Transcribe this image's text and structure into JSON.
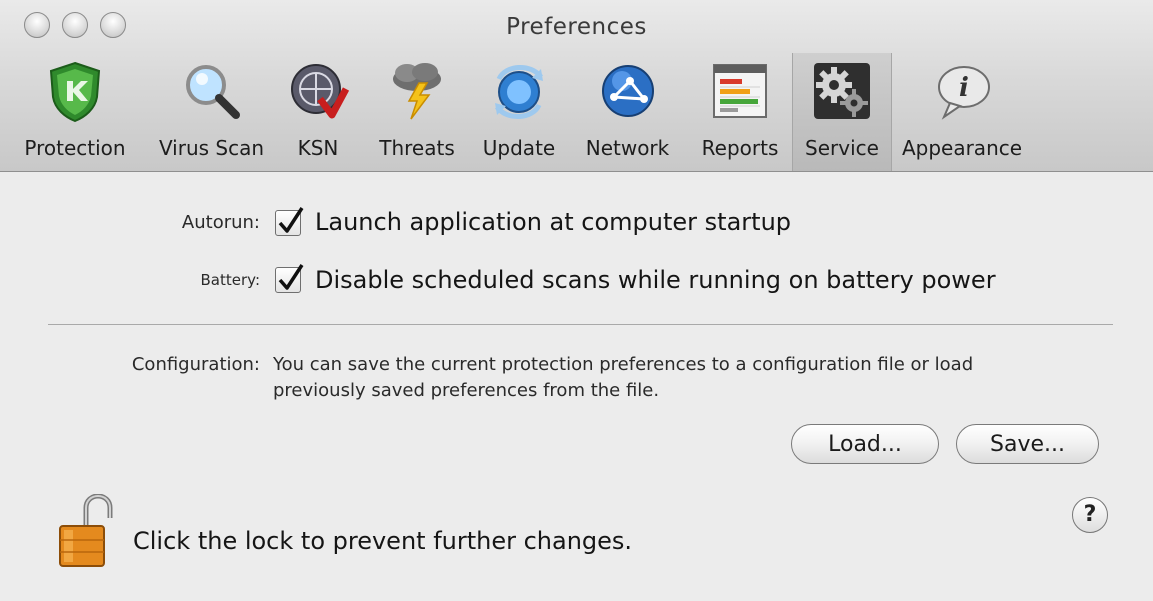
{
  "window": {
    "title": "Preferences"
  },
  "toolbar": {
    "items": [
      {
        "label": "Protection",
        "icon": "protection-shield-icon"
      },
      {
        "label": "Virus Scan",
        "icon": "magnifier-icon"
      },
      {
        "label": "KSN",
        "icon": "ksn-globe-icon"
      },
      {
        "label": "Threats",
        "icon": "storm-cloud-icon"
      },
      {
        "label": "Update",
        "icon": "update-sync-icon"
      },
      {
        "label": "Network",
        "icon": "network-globe-icon"
      },
      {
        "label": "Reports",
        "icon": "report-chart-icon"
      },
      {
        "label": "Service",
        "icon": "gears-icon"
      },
      {
        "label": "Appearance",
        "icon": "info-bubble-icon"
      }
    ],
    "selected": "Service"
  },
  "settings": {
    "autorun": {
      "label": "Autorun:",
      "checked": true,
      "text": "Launch application at computer startup"
    },
    "battery": {
      "label": "Battery:",
      "checked": true,
      "text": "Disable scheduled scans while running on battery power"
    }
  },
  "configuration": {
    "label": "Configuration:",
    "description_line1": "You can save the current protection preferences to a configuration file or load",
    "description_line2": "previously saved preferences from the file.",
    "load_label": "Load...",
    "save_label": "Save..."
  },
  "lock": {
    "text": "Click the lock to prevent further changes.",
    "icon": "open-padlock-icon"
  },
  "help": {
    "label": "?"
  },
  "colors": {
    "toolbar_bg": "#d4d4d4",
    "window_bg": "#ececec",
    "accent_green": "#3f9a35",
    "lock_orange": "#e08a20"
  }
}
